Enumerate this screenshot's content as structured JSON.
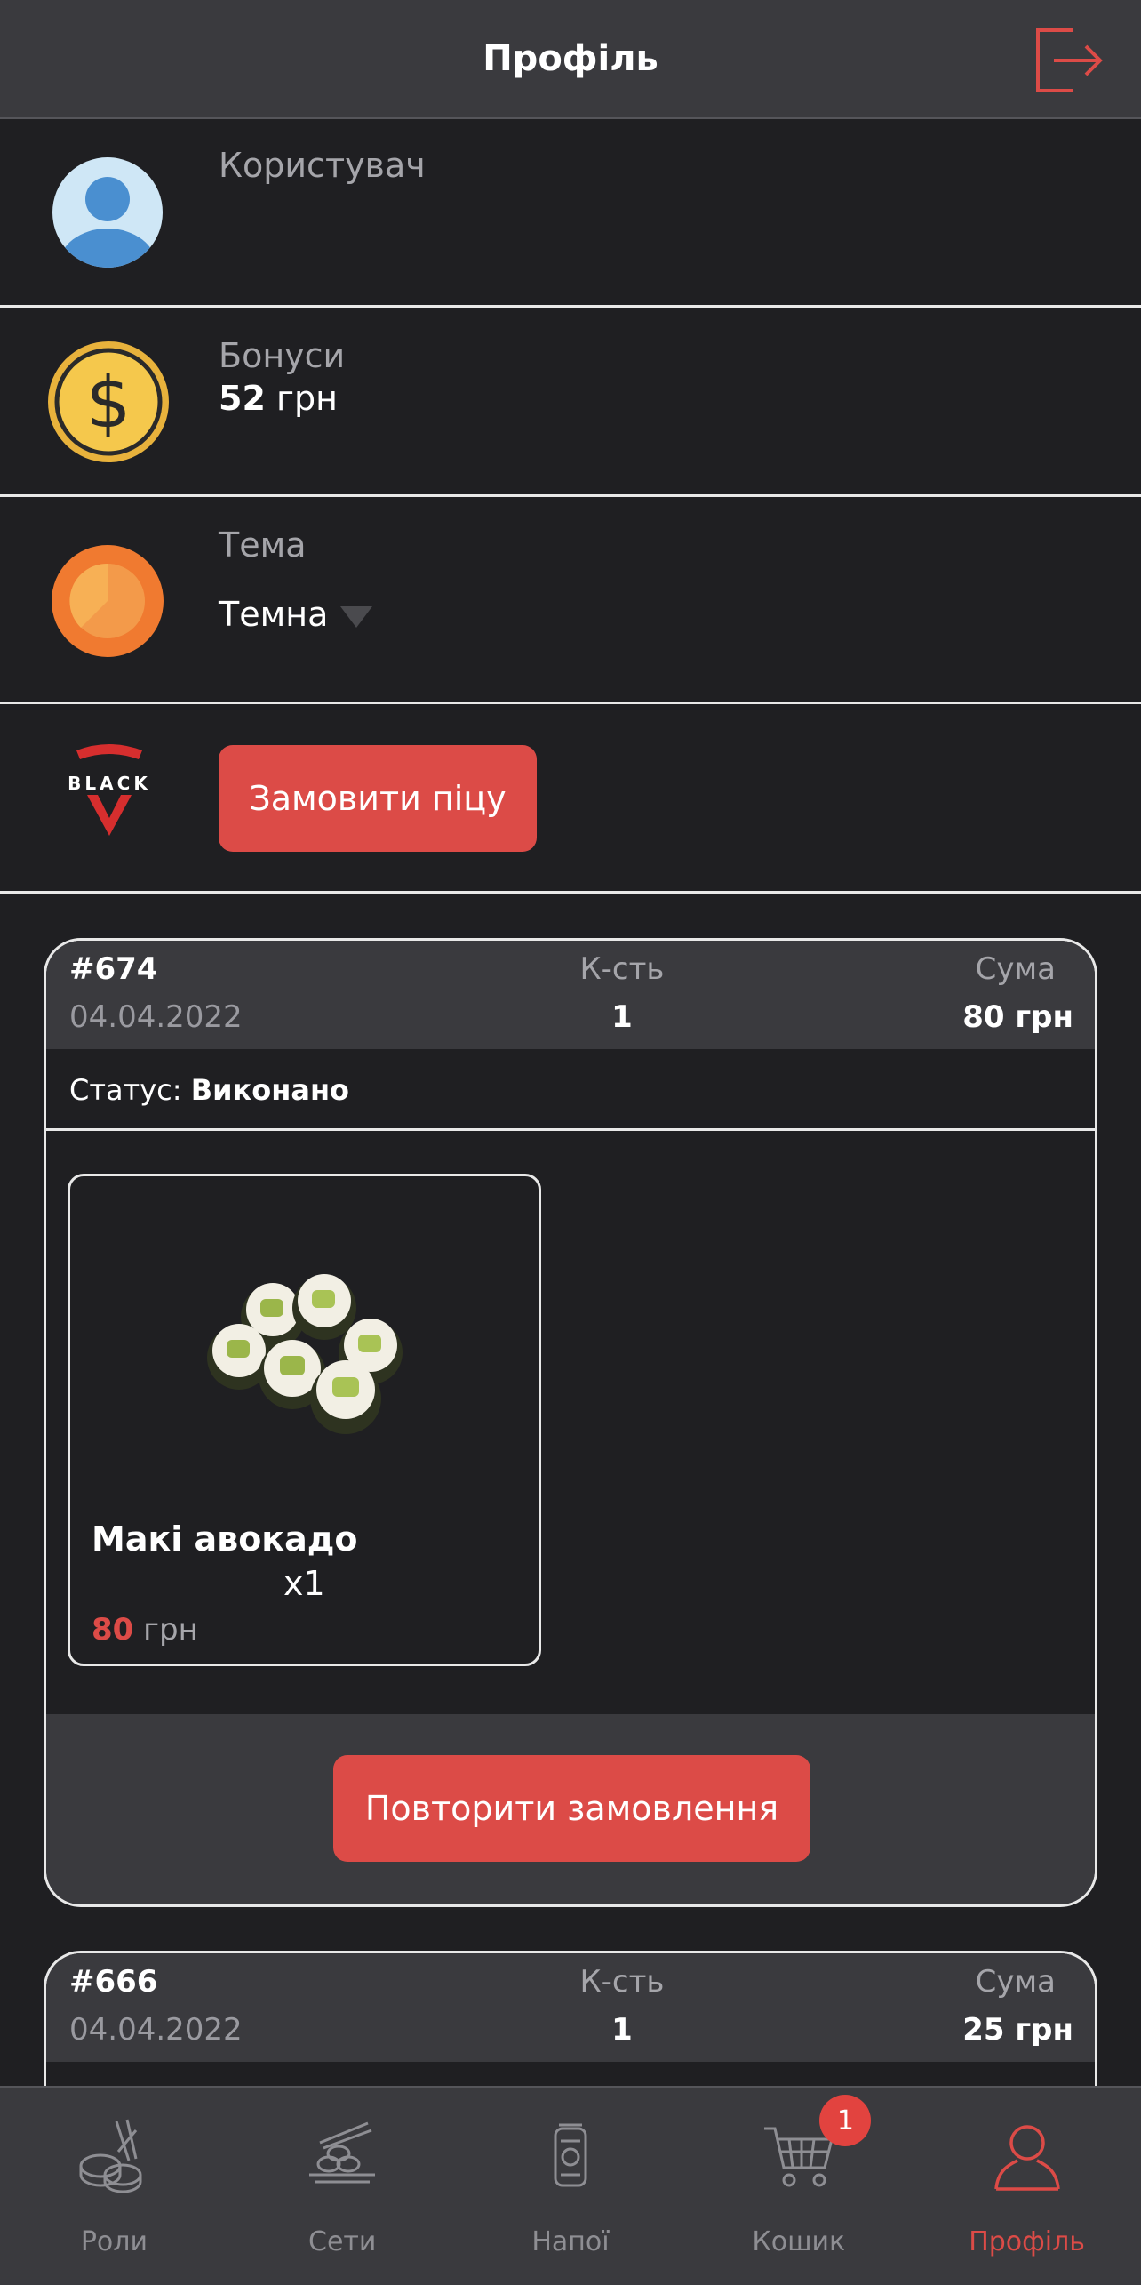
{
  "header": {
    "title": "Профіль"
  },
  "profile": {
    "user_label": "Користувач",
    "bonus_label": "Бонуси",
    "bonus_value": "52",
    "bonus_unit": "грн",
    "theme_label": "Тема",
    "theme_value": "Темна",
    "order_pizza_button": "Замовити піцу",
    "brand_logo_text": "BLACK"
  },
  "orders": [
    {
      "id": "#674",
      "date": "04.04.2022",
      "qty_label": "К-сть",
      "qty": "1",
      "sum_label": "Сума",
      "sum": "80 грн",
      "status_label": "Статус:",
      "status_value": "Виконано",
      "item": {
        "name": "Макі авокадо",
        "qty": "x1",
        "price": "80",
        "price_unit": "грн"
      },
      "repeat_button": "Повторити замовлення"
    },
    {
      "id": "#666",
      "date": "04.04.2022",
      "qty_label": "К-сть",
      "qty": "1",
      "sum_label": "Сума",
      "sum": "25 грн"
    }
  ],
  "nav": {
    "items": [
      {
        "label": "Роли",
        "icon": "sushi-rolls-icon"
      },
      {
        "label": "Сети",
        "icon": "sushi-set-icon"
      },
      {
        "label": "Напої",
        "icon": "drink-can-icon"
      },
      {
        "label": "Кошик",
        "icon": "cart-icon",
        "badge": "1"
      },
      {
        "label": "Профіль",
        "icon": "user-icon",
        "active": true
      }
    ]
  },
  "colors": {
    "accent": "#dc4b47",
    "bg": "#1f1f22",
    "panel": "#3a3a3e",
    "coin": "#f5c84c",
    "theme_orange": "#f07a30"
  }
}
